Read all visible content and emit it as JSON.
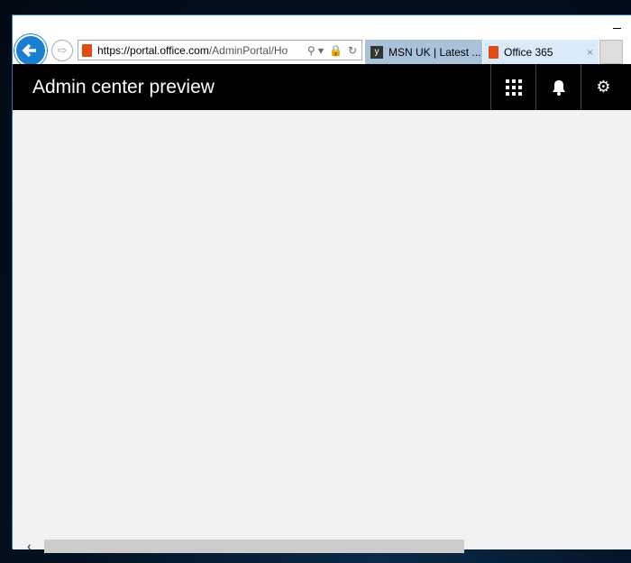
{
  "browser": {
    "url_prefix": "https://portal.",
    "url_domain": "office.com",
    "url_path": "/AdminPortal/Ho",
    "tabs": [
      {
        "label": "MSN UK | Latest ..."
      },
      {
        "label": "Office 365",
        "close": "×"
      }
    ]
  },
  "header": {
    "title": "Admin center preview"
  },
  "icons": {
    "back": "←",
    "forward": "⇨",
    "search": "⚲",
    "lock": "🔒",
    "refresh": "↻",
    "apps": "⋮⋮⋮",
    "bell": "🔔",
    "gear": "⚙",
    "scroll_left": "‹"
  }
}
